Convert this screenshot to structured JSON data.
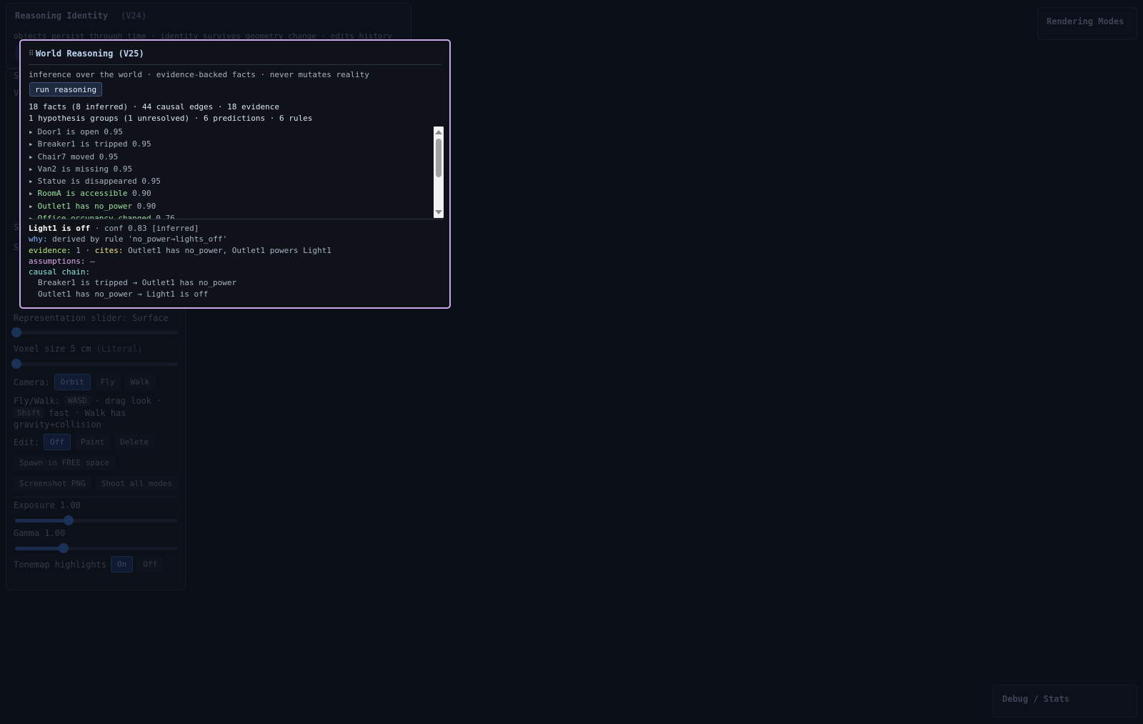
{
  "background": {
    "panel_top": {
      "title": "Reasoning Identity",
      "title_overlay": "(V24)",
      "subtitle": "objects persist through time · identity survives geometry change · edits history"
    },
    "side": {
      "fragments": [
        "Se",
        "V",
        "S",
        "S"
      ],
      "representation_label": "Representation slider: Surface",
      "representation_value": 0.0,
      "voxel_label": "Voxel size 5 cm",
      "voxel_mode": "(Literal)",
      "voxel_value": 0.0,
      "camera_label": "Camera:",
      "camera_modes": [
        "Orbit",
        "Fly",
        "Walk"
      ],
      "hint_prefix": "Fly/Walk:",
      "hint_key1": "WASD",
      "hint_mid": "· drag look ·",
      "hint_key2": "Shift",
      "hint_suffix": "fast · Walk has",
      "hint_line3": "gravity+collision",
      "edit_label": "Edit:",
      "edit_modes": [
        "Off",
        "Paint",
        "Delete"
      ],
      "spawn_button": "Spawn in FREE space",
      "screenshot_button": "Screenshot PNG",
      "shoot_button": "Shoot all modes",
      "exposure_label": "Exposure 1.00",
      "exposure_value": 0.33,
      "gamma_label": "Gamma 1.00",
      "gamma_value": 0.3,
      "tonemap_label": "Tonemap highlights",
      "tonemap_on": "On",
      "tonemap_off": "Off"
    },
    "rendering_modes_title": "Rendering Modes",
    "debug_title": "Debug / Stats"
  },
  "world_reasoning": {
    "title": "World Reasoning (V25)",
    "description": "inference over the world · evidence-backed facts · never mutates reality",
    "run_button": "run reasoning",
    "stats_line1": "18 facts (8 inferred) · 44 causal edges · 18 evidence",
    "stats_line2": "1 hypothesis groups (1 unresolved) · 6 predictions · 6 rules",
    "facts": [
      {
        "text": "Door1 is open",
        "conf": "0.95",
        "inferred": false
      },
      {
        "text": "Breaker1 is tripped",
        "conf": "0.95",
        "inferred": false
      },
      {
        "text": "Chair7 moved",
        "conf": "0.95",
        "inferred": false
      },
      {
        "text": "Van2 is missing",
        "conf": "0.95",
        "inferred": false
      },
      {
        "text": "Statue is disappeared",
        "conf": "0.95",
        "inferred": false
      },
      {
        "text": "RoomA is accessible",
        "conf": "0.90",
        "inferred": true
      },
      {
        "text": "Outlet1 has no_power",
        "conf": "0.90",
        "inferred": true
      },
      {
        "text": "Office occupancy changed",
        "conf": "0.76",
        "inferred": true
      }
    ],
    "detail": {
      "fact": "Light1 is off",
      "conf_text": "· conf 0.83 [inferred]",
      "why_label": "why:",
      "why_text": "derived by rule 'no_power→lights_off'",
      "evidence_label": "evidence:",
      "evidence_count": "1",
      "cites_label": "cites:",
      "cites_text": "Outlet1 has no_power, Outlet1 powers Light1",
      "assumptions_label": "assumptions:",
      "assumptions_text": "—",
      "chain_label": "causal chain:",
      "chain": [
        "Breaker1 is tripped → Outlet1 has no_power",
        "Outlet1 has no_power → Light1 is off"
      ]
    }
  }
}
